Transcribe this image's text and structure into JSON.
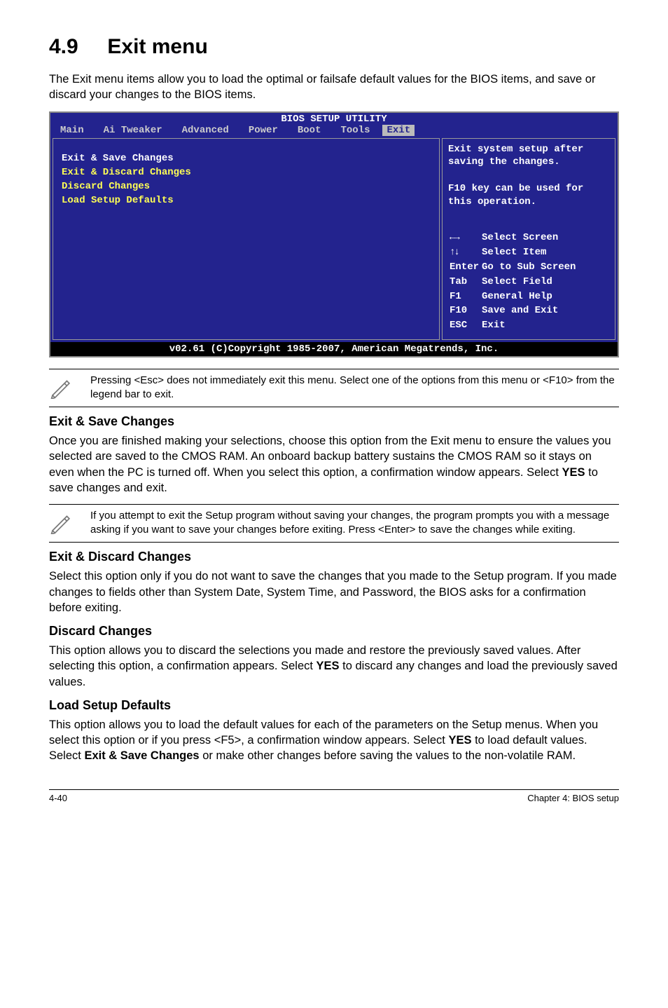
{
  "header": {
    "number": "4.9",
    "title": "Exit menu"
  },
  "intro": "The Exit menu items allow you to load the optimal or failsafe default values for the BIOS items, and save or discard your changes to the BIOS items.",
  "bios": {
    "title": "BIOS SETUP UTILITY",
    "menus": [
      "Main",
      "Ai Tweaker",
      "Advanced",
      "Power",
      "Boot",
      "Tools",
      "Exit"
    ],
    "left_items": [
      "Exit & Save Changes",
      "Exit & Discard Changes",
      "Discard Changes",
      "",
      "Load Setup Defaults"
    ],
    "help_top": "Exit system setup after saving the changes.\n\nF10 key can be used for this operation.",
    "keys": [
      {
        "k": "←→",
        "v": "Select Screen"
      },
      {
        "k": "↑↓",
        "v": "Select Item"
      },
      {
        "k": "Enter",
        "v": "Go to Sub Screen"
      },
      {
        "k": "Tab",
        "v": "Select Field"
      },
      {
        "k": "F1",
        "v": "General Help"
      },
      {
        "k": "F10",
        "v": "Save and Exit"
      },
      {
        "k": "ESC",
        "v": "Exit"
      }
    ],
    "footer": "v02.61 (C)Copyright 1985-2007, American Megatrends, Inc."
  },
  "note1": "Pressing <Esc> does not immediately exit this menu. Select one of the options from this menu or <F10> from the legend bar to exit.",
  "sections": {
    "save": {
      "title": "Exit & Save Changes",
      "body_pre": "Once you are finished making your selections, choose this option from the Exit menu to ensure the values you selected are saved to the CMOS RAM. An onboard backup battery sustains the CMOS RAM so it stays on even when the PC is turned off. When you select this option, a confirmation window appears. Select ",
      "body_bold": "YES",
      "body_post": " to save changes and exit."
    },
    "note2": "If you attempt to exit the Setup program without saving your changes, the program prompts you with a message asking if you want to save your changes before exiting. Press <Enter> to save the changes while exiting.",
    "discard_exit": {
      "title": "Exit & Discard Changes",
      "body": "Select this option only if you do not want to save the changes that you  made to the Setup program. If you made changes to fields other than System Date, System Time, and Password, the BIOS asks for a confirmation before exiting."
    },
    "discard": {
      "title": "Discard Changes",
      "body_pre": "This option allows you to discard the selections you made and restore the previously saved values. After selecting this option, a confirmation appears. Select ",
      "body_bold": "YES",
      "body_post": " to discard any changes and load the previously saved values."
    },
    "load": {
      "title": "Load Setup Defaults",
      "body_pre": "This option allows you to load the default values for each of the parameters on the Setup menus. When you select this option or if you press <F5>, a confirmation window appears. Select ",
      "body_b1": "YES",
      "body_mid": " to load default values. Select ",
      "body_b2": "Exit & Save Changes",
      "body_post": " or make other changes before saving the values to the non-volatile RAM."
    }
  },
  "footer": {
    "left": "4-40",
    "right": "Chapter 4: BIOS setup"
  }
}
